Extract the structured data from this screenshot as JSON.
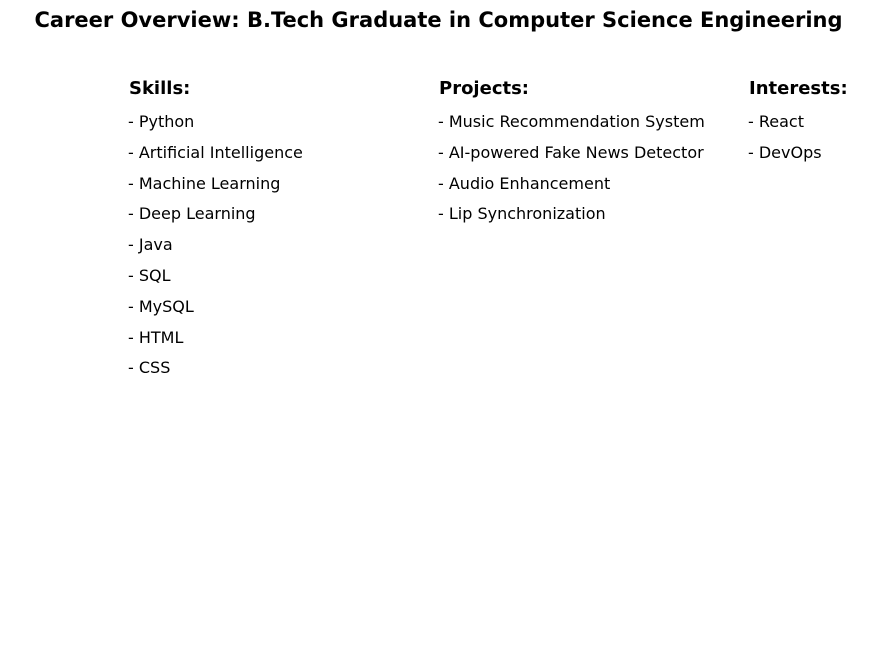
{
  "title": "Career Overview: B.Tech Graduate in Computer Science Engineering",
  "sections": {
    "skills": {
      "heading": "Skills:",
      "items": [
        "- Python",
        "- Artificial Intelligence",
        "- Machine Learning",
        "- Deep Learning",
        "- Java",
        "- SQL",
        "- MySQL",
        "- HTML",
        "- CSS"
      ]
    },
    "projects": {
      "heading": "Projects:",
      "items": [
        "- Music Recommendation System",
        "- AI-powered Fake News Detector",
        "- Audio Enhancement",
        "- Lip Synchronization"
      ]
    },
    "interests": {
      "heading": "Interests:",
      "items": [
        "- React",
        "- DevOps"
      ]
    }
  }
}
